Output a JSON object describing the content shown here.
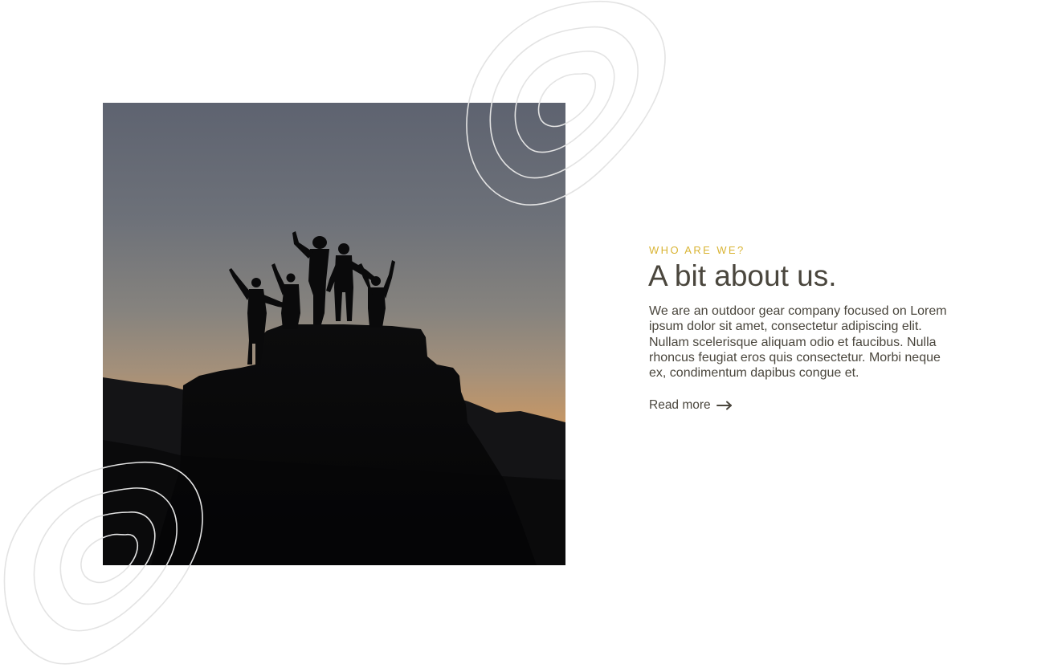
{
  "about": {
    "eyebrow": "WHO ARE WE?",
    "heading": "A bit about us.",
    "body": "We are an outdoor gear company focused on Lorem ipsum dolor sit amet, consectetur adipiscing elit. Nullam scelerisque aliquam odio et faucibus. Nulla rhoncus feugiat eros quis consectetur. Morbi neque ex, condimentum dapibus congue et.",
    "link_label": "Read more",
    "link_icon": "arrow-right-icon"
  },
  "image": {
    "subject": "group-silhouette-on-mountain-peak-at-sunset"
  },
  "colors": {
    "accent": "#d9b434",
    "text": "#4a463d",
    "decoration": "#e3e3e3",
    "background": "#ffffff"
  }
}
